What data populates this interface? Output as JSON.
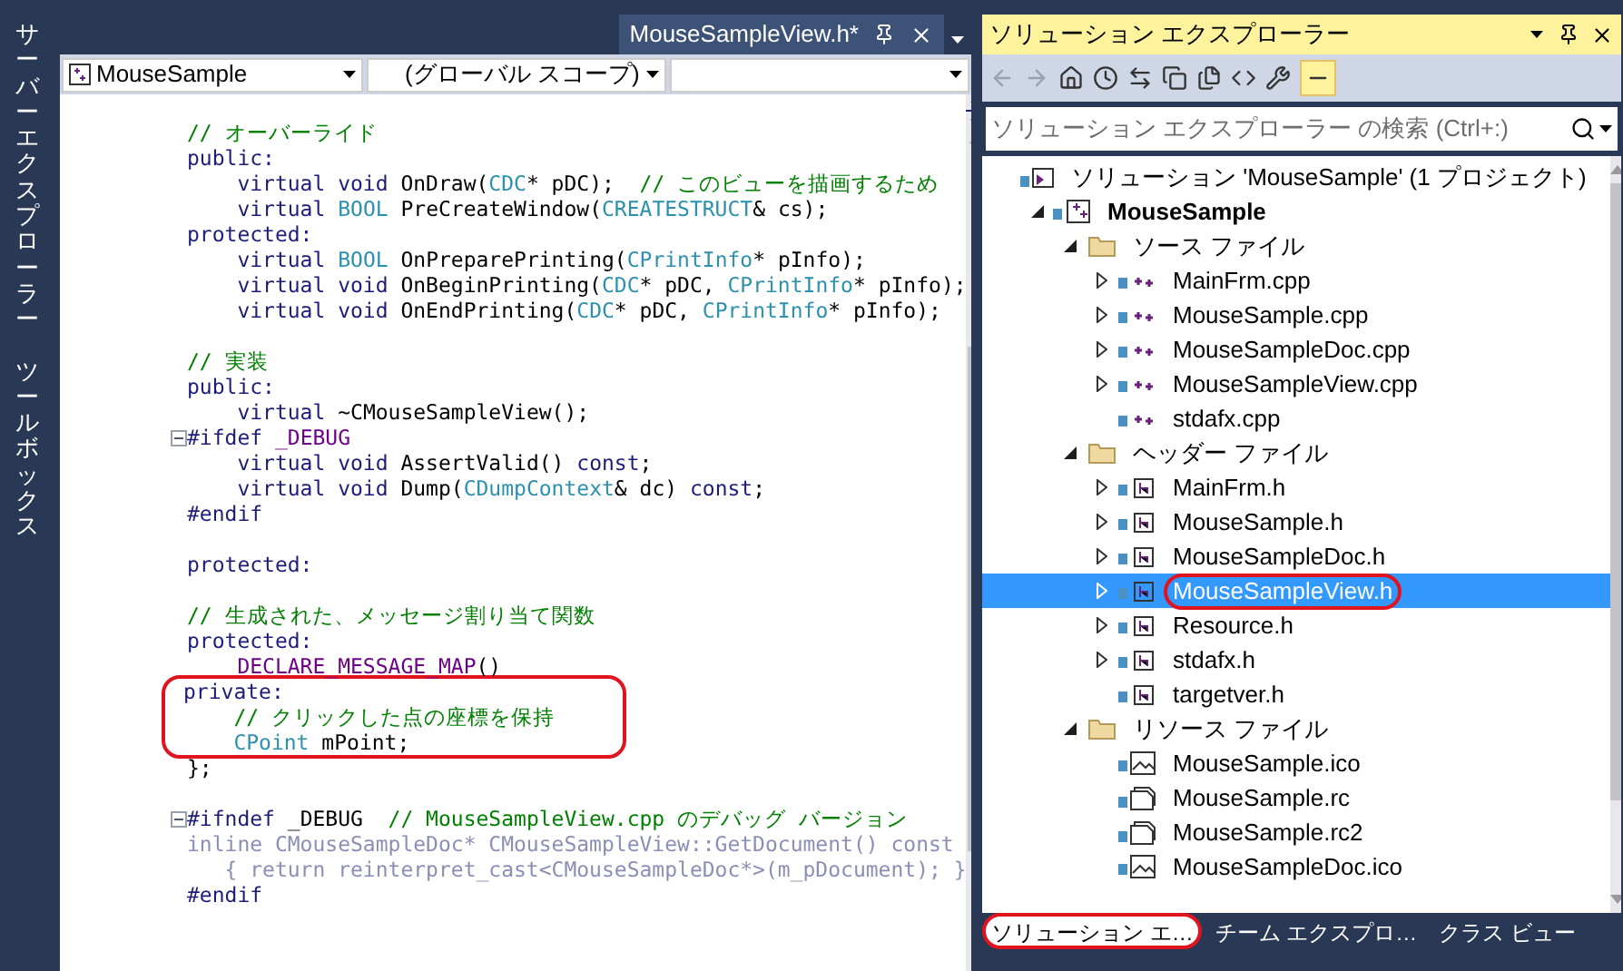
{
  "side_tabs": [
    "サーバーエクスプローラー",
    "ツールボックス"
  ],
  "editor": {
    "tab": {
      "title": "MouseSampleView.h*",
      "selected": true
    },
    "nav": {
      "project": "MouseSample",
      "scope": "(グローバル スコープ)"
    },
    "lines": [
      {
        "fold": false,
        "circled": false,
        "segments": [
          {
            "kind": "comment",
            "text": "// オーバーライド"
          }
        ]
      },
      {
        "fold": false,
        "circled": false,
        "segments": [
          {
            "kind": "keyword",
            "text": "public:"
          }
        ]
      },
      {
        "fold": false,
        "circled": false,
        "segments": [
          {
            "kind": "keyword",
            "text": "    virtual void"
          },
          {
            "kind": "plain",
            "text": " OnDraw("
          },
          {
            "kind": "type",
            "text": "CDC"
          },
          {
            "kind": "plain",
            "text": "* pDC);  "
          },
          {
            "kind": "comment",
            "text": "// このビューを描画するため"
          }
        ]
      },
      {
        "fold": false,
        "circled": false,
        "segments": [
          {
            "kind": "keyword",
            "text": "    virtual "
          },
          {
            "kind": "type",
            "text": "BOOL"
          },
          {
            "kind": "plain",
            "text": " PreCreateWindow("
          },
          {
            "kind": "type",
            "text": "CREATESTRUCT"
          },
          {
            "kind": "plain",
            "text": "& cs);"
          }
        ]
      },
      {
        "fold": false,
        "circled": false,
        "segments": [
          {
            "kind": "keyword",
            "text": "protected:"
          }
        ]
      },
      {
        "fold": false,
        "circled": false,
        "segments": [
          {
            "kind": "keyword",
            "text": "    virtual "
          },
          {
            "kind": "type",
            "text": "BOOL"
          },
          {
            "kind": "plain",
            "text": " OnPreparePrinting("
          },
          {
            "kind": "type",
            "text": "CPrintInfo"
          },
          {
            "kind": "plain",
            "text": "* pInfo);"
          }
        ]
      },
      {
        "fold": false,
        "circled": false,
        "segments": [
          {
            "kind": "keyword",
            "text": "    virtual void"
          },
          {
            "kind": "plain",
            "text": " OnBeginPrinting("
          },
          {
            "kind": "type",
            "text": "CDC"
          },
          {
            "kind": "plain",
            "text": "* pDC, "
          },
          {
            "kind": "type",
            "text": "CPrintInfo"
          },
          {
            "kind": "plain",
            "text": "* pInfo);"
          }
        ]
      },
      {
        "fold": false,
        "circled": false,
        "segments": [
          {
            "kind": "keyword",
            "text": "    virtual void"
          },
          {
            "kind": "plain",
            "text": " OnEndPrinting("
          },
          {
            "kind": "type",
            "text": "CDC"
          },
          {
            "kind": "plain",
            "text": "* pDC, "
          },
          {
            "kind": "type",
            "text": "CPrintInfo"
          },
          {
            "kind": "plain",
            "text": "* pInfo);"
          }
        ]
      },
      {
        "fold": false,
        "circled": false
      },
      {
        "fold": false,
        "circled": false,
        "segments": [
          {
            "kind": "comment",
            "text": "// 実装"
          }
        ]
      },
      {
        "fold": false,
        "circled": false,
        "segments": [
          {
            "kind": "keyword",
            "text": "public:"
          }
        ]
      },
      {
        "fold": false,
        "circled": false,
        "segments": [
          {
            "kind": "keyword",
            "text": "    virtual"
          },
          {
            "kind": "plain",
            "text": " ~CMouseSampleView();"
          }
        ]
      },
      {
        "fold": true,
        "circled": false,
        "segments": [
          {
            "kind": "keyword",
            "text": "#ifdef "
          },
          {
            "kind": "macro",
            "text": "_DEBUG"
          }
        ]
      },
      {
        "fold": false,
        "circled": false,
        "segments": [
          {
            "kind": "keyword",
            "text": "    virtual void"
          },
          {
            "kind": "plain",
            "text": " AssertValid() "
          },
          {
            "kind": "keyword",
            "text": "const"
          },
          {
            "kind": "plain",
            "text": ";"
          }
        ]
      },
      {
        "fold": false,
        "circled": false,
        "segments": [
          {
            "kind": "keyword",
            "text": "    virtual void"
          },
          {
            "kind": "plain",
            "text": " Dump("
          },
          {
            "kind": "type",
            "text": "CDumpContext"
          },
          {
            "kind": "plain",
            "text": "& dc) "
          },
          {
            "kind": "keyword",
            "text": "const"
          },
          {
            "kind": "plain",
            "text": ";"
          }
        ]
      },
      {
        "fold": false,
        "circled": false,
        "segments": [
          {
            "kind": "keyword",
            "text": "#endif"
          }
        ]
      },
      {
        "fold": false,
        "circled": false
      },
      {
        "fold": false,
        "circled": false,
        "segments": [
          {
            "kind": "keyword",
            "text": "protected:"
          }
        ]
      },
      {
        "fold": false,
        "circled": false
      },
      {
        "fold": false,
        "circled": false,
        "segments": [
          {
            "kind": "comment",
            "text": "// 生成された、メッセージ割り当て関数"
          }
        ]
      },
      {
        "fold": false,
        "circled": false,
        "segments": [
          {
            "kind": "keyword",
            "text": "protected:"
          }
        ]
      },
      {
        "fold": false,
        "circled": false,
        "segments": [
          {
            "kind": "macro",
            "text": "    DECLARE_MESSAGE_MAP"
          },
          {
            "kind": "plain",
            "text": "()"
          }
        ]
      },
      {
        "fold": false,
        "circled": true,
        "segments": [
          {
            "kind": "keyword",
            "text": "private:"
          }
        ]
      },
      {
        "fold": false,
        "circled": true,
        "segments": [
          {
            "kind": "comment",
            "text": "    // クリックした点の座標を保持"
          }
        ]
      },
      {
        "fold": false,
        "circled": true,
        "segments": [
          {
            "kind": "type",
            "text": "    CPoint"
          },
          {
            "kind": "plain",
            "text": " mPoint;"
          }
        ]
      },
      {
        "fold": false,
        "circled": false,
        "segments": [
          {
            "kind": "plain",
            "text": "};"
          }
        ]
      },
      {
        "fold": false,
        "circled": false
      },
      {
        "fold": true,
        "circled": false,
        "segments": [
          {
            "kind": "keyword",
            "text": "#ifndef"
          },
          {
            "kind": "plain",
            "text": " _DEBUG  "
          },
          {
            "kind": "comment",
            "text": "// MouseSampleView.cpp のデバッグ バージョン"
          }
        ]
      },
      {
        "fold": false,
        "circled": false,
        "segments": [
          {
            "kind": "inactive",
            "text": "inline CMouseSampleDoc* CMouseSampleView::GetDocument() const"
          }
        ]
      },
      {
        "fold": false,
        "circled": false,
        "segments": [
          {
            "kind": "inactive",
            "text": "   { return reinterpret_cast<CMouseSampleDoc*>(m_pDocument); }"
          }
        ]
      },
      {
        "fold": false,
        "circled": false,
        "segments": [
          {
            "kind": "keyword",
            "text": "#endif"
          }
        ]
      }
    ]
  },
  "solution_explorer": {
    "title": "ソリューション エクスプローラー",
    "search": {
      "placeholder": "ソリューション エクスプローラー の検索 (Ctrl+:)"
    },
    "tree": [
      {
        "label": "ソリューション 'MouseSample' (1 プロジェクト)",
        "kind": "solution",
        "selected": false,
        "circled": false,
        "children": [
          {
            "label": "MouseSample",
            "kind": "project",
            "expanded": true,
            "selected": false,
            "circled": false,
            "children": [
              {
                "label": "ソース ファイル",
                "kind": "folder",
                "expanded": true,
                "selected": false,
                "circled": false,
                "children": [
                  {
                    "label": "MainFrm.cpp",
                    "kind": "cpp",
                    "expanded": false,
                    "selected": false,
                    "circled": false
                  },
                  {
                    "label": "MouseSample.cpp",
                    "kind": "cpp",
                    "expanded": false,
                    "selected": false,
                    "circled": false
                  },
                  {
                    "label": "MouseSampleDoc.cpp",
                    "kind": "cpp",
                    "expanded": false,
                    "selected": false,
                    "circled": false
                  },
                  {
                    "label": "MouseSampleView.cpp",
                    "kind": "cpp",
                    "expanded": false,
                    "selected": false,
                    "circled": false
                  },
                  {
                    "label": "stdafx.cpp",
                    "kind": "cpp",
                    "selected": false,
                    "circled": false
                  }
                ]
              },
              {
                "label": "ヘッダー ファイル",
                "kind": "folder",
                "expanded": true,
                "selected": false,
                "circled": false,
                "children": [
                  {
                    "label": "MainFrm.h",
                    "kind": "h",
                    "expanded": false,
                    "selected": false,
                    "circled": false
                  },
                  {
                    "label": "MouseSample.h",
                    "kind": "h",
                    "expanded": false,
                    "selected": false,
                    "circled": false
                  },
                  {
                    "label": "MouseSampleDoc.h",
                    "kind": "h",
                    "expanded": false,
                    "selected": false,
                    "circled": false
                  },
                  {
                    "label": "MouseSampleView.h",
                    "kind": "h",
                    "expanded": false,
                    "selected": true,
                    "circled": true
                  },
                  {
                    "label": "Resource.h",
                    "kind": "h",
                    "expanded": false,
                    "selected": false,
                    "circled": false
                  },
                  {
                    "label": "stdafx.h",
                    "kind": "h",
                    "expanded": false,
                    "selected": false,
                    "circled": false
                  },
                  {
                    "label": "targetver.h",
                    "kind": "h",
                    "selected": false,
                    "circled": false
                  }
                ]
              },
              {
                "label": "リソース ファイル",
                "kind": "folder",
                "expanded": true,
                "selected": false,
                "circled": false,
                "children": [
                  {
                    "label": "MouseSample.ico",
                    "kind": "image",
                    "selected": false,
                    "circled": false
                  },
                  {
                    "label": "MouseSample.rc",
                    "kind": "resource",
                    "selected": false,
                    "circled": false
                  },
                  {
                    "label": "MouseSample.rc2",
                    "kind": "resource",
                    "selected": false,
                    "circled": false
                  },
                  {
                    "label": "MouseSampleDoc.ico",
                    "kind": "image",
                    "selected": false,
                    "circled": false
                  }
                ]
              }
            ]
          }
        ]
      }
    ],
    "bottom_tabs": [
      {
        "label": "ソリューション エ…",
        "selected": true,
        "circled": true
      },
      {
        "label": "チーム エクスプロ…",
        "selected": false,
        "circled": false
      },
      {
        "label": "クラス ビュー",
        "selected": false,
        "circled": false
      }
    ]
  }
}
